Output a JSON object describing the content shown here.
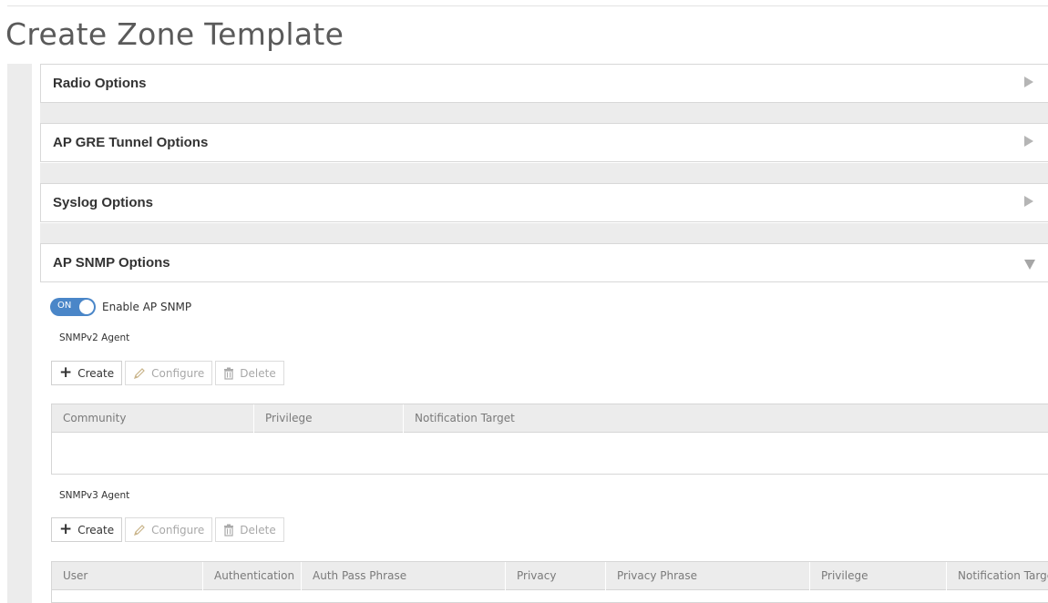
{
  "page": {
    "title": "Create Zone Template"
  },
  "sections": {
    "radio": {
      "title": "Radio Options"
    },
    "gre": {
      "title": "AP GRE Tunnel Options"
    },
    "syslog": {
      "title": "Syslog Options"
    },
    "snmp": {
      "title": "AP SNMP Options"
    }
  },
  "snmp": {
    "toggle_state": "ON",
    "enable_label": "Enable AP SNMP",
    "v2": {
      "title": "SNMPv2 Agent",
      "buttons": {
        "create": "Create",
        "configure": "Configure",
        "delete": "Delete"
      },
      "columns": [
        "Community",
        "Privilege",
        "Notification Target"
      ]
    },
    "v3": {
      "title": "SNMPv3 Agent",
      "buttons": {
        "create": "Create",
        "configure": "Configure",
        "delete": "Delete"
      },
      "columns": [
        "User",
        "Authentication",
        "Auth Pass Phrase",
        "Privacy",
        "Privacy Phrase",
        "Privilege",
        "Notification Target"
      ]
    }
  },
  "icons": {
    "collapsed": "triangle-right-icon",
    "expanded": "triangle-down-icon",
    "create": "plus-icon",
    "configure": "pencil-icon",
    "delete": "trash-icon"
  },
  "colors": {
    "toggle_on": "#4a86c8"
  }
}
